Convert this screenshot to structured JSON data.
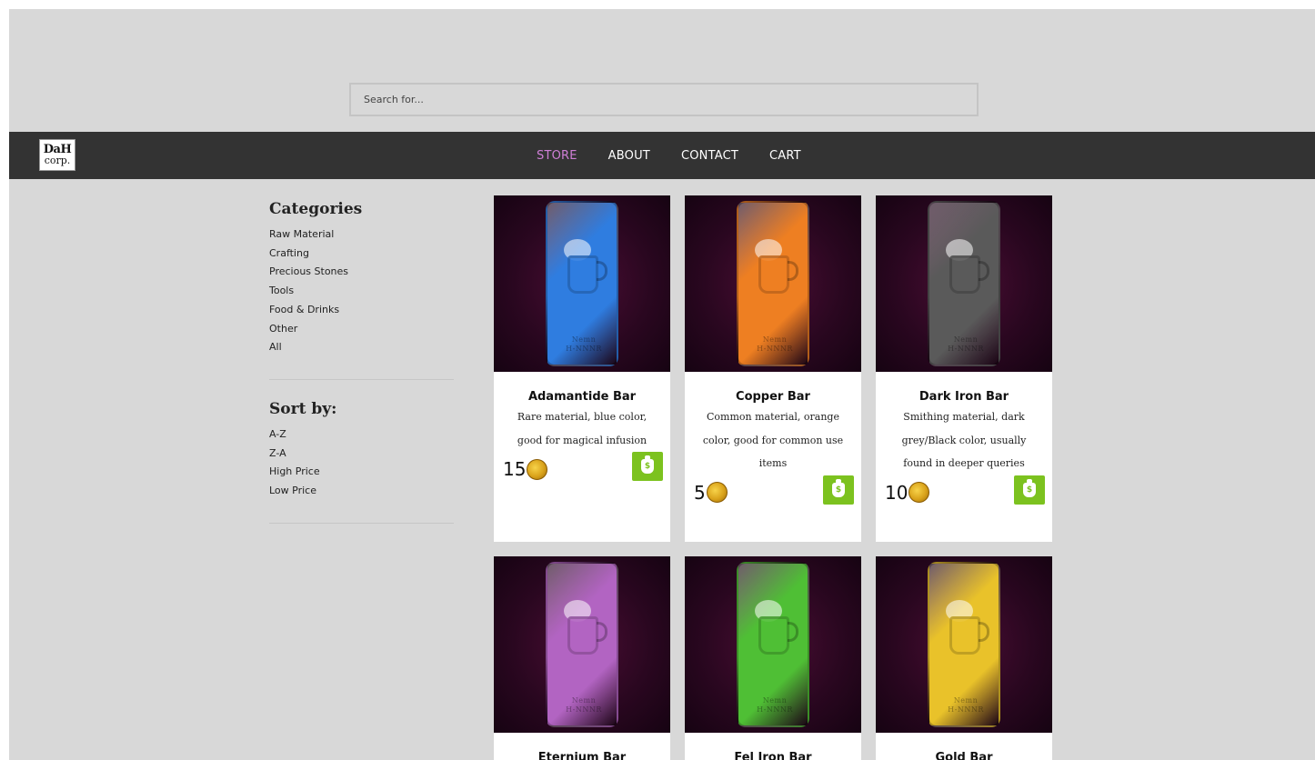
{
  "search": {
    "placeholder": "Search for..."
  },
  "logo": {
    "line1": "DaH",
    "line2": "corp."
  },
  "nav": [
    {
      "label": "STORE",
      "active": true
    },
    {
      "label": "ABOUT",
      "active": false
    },
    {
      "label": "CONTACT",
      "active": false
    },
    {
      "label": "CART",
      "active": false
    }
  ],
  "sidebar": {
    "categories_heading": "Categories",
    "categories": [
      "Raw Material",
      "Crafting",
      "Precious Stones",
      "Tools",
      "Food & Drinks",
      "Other",
      "All"
    ],
    "sort_heading": "Sort by:",
    "sort_options": [
      "A-Z",
      "Z-A",
      "High Price",
      "Low Price"
    ]
  },
  "products": [
    {
      "name": "Adamantide Bar",
      "description": "Rare material, blue color, good for magical infusion",
      "price": "15",
      "color": "#2f7de0"
    },
    {
      "name": "Copper Bar",
      "description": "Common material, orange color, good for common use items",
      "price": "5",
      "color": "#ee7f22"
    },
    {
      "name": "Dark Iron Bar",
      "description": "Smithing material, dark grey/Black color, usually found in deeper queries",
      "price": "10",
      "color": "#5a5a5a"
    },
    {
      "name": "Eternium Bar",
      "description": "",
      "price": "",
      "color": "#b264c2"
    },
    {
      "name": "Fel Iron Bar",
      "description": "",
      "price": "",
      "color": "#4fbf35"
    },
    {
      "name": "Gold Bar",
      "description": "",
      "price": "",
      "color": "#e9c22a"
    }
  ],
  "bar_stamp": {
    "line1": "Nemn",
    "line2": "H-NNNR"
  },
  "buy_glyph": "$",
  "colors": {
    "nav_bg": "#333333",
    "nav_active": "#cf7fd6",
    "buy_button": "#7cc21f",
    "page_bg": "#d8d8d8"
  },
  "icons": {
    "coin": "gold-coin-icon",
    "buy": "money-bag-icon"
  }
}
